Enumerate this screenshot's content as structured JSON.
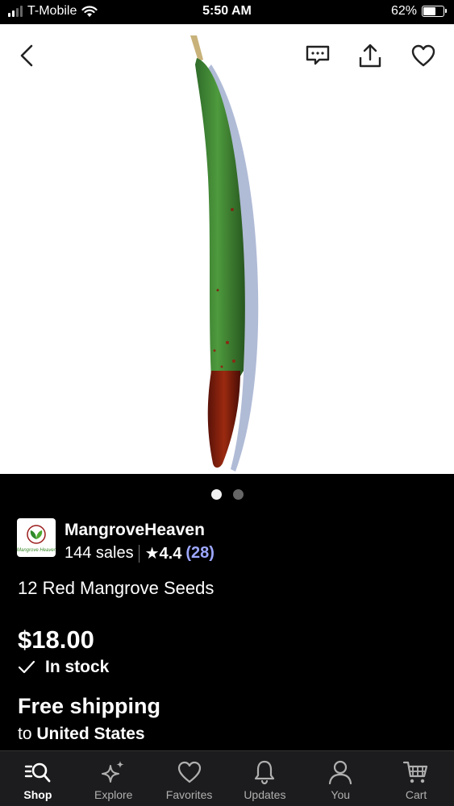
{
  "status_bar": {
    "carrier": "T-Mobile",
    "time": "5:50 AM",
    "battery": "62%",
    "battery_level": 0.62
  },
  "header": {
    "back_icon": "chevron-left-icon",
    "message_icon": "message-icon",
    "share_icon": "share-icon",
    "favorite_icon": "heart-icon"
  },
  "gallery": {
    "image_count": 2,
    "current_index": 0
  },
  "shop": {
    "name": "MangroveHeaven",
    "logo_text": "Mangrove Heaven",
    "sales": "144 sales",
    "rating": "★4.4",
    "reviews": "(28)"
  },
  "listing": {
    "title": "12 Red Mangrove Seeds",
    "price": "$18.00",
    "stock": "In stock",
    "shipping_title": "Free shipping",
    "shipping_prefix": "to",
    "shipping_destination": "United States"
  },
  "bottom_nav": {
    "items": [
      {
        "label": "Shop",
        "icon": "search-icon",
        "active": true
      },
      {
        "label": "Explore",
        "icon": "sparkle-icon",
        "active": false
      },
      {
        "label": "Favorites",
        "icon": "heart-icon",
        "active": false
      },
      {
        "label": "Updates",
        "icon": "bell-icon",
        "active": false
      },
      {
        "label": "You",
        "icon": "person-icon",
        "active": false
      },
      {
        "label": "Cart",
        "icon": "cart-icon",
        "active": false
      }
    ]
  },
  "colors": {
    "background": "#000000",
    "reviews_link": "#9ea8ff",
    "nav_background": "#1c1c1e"
  }
}
